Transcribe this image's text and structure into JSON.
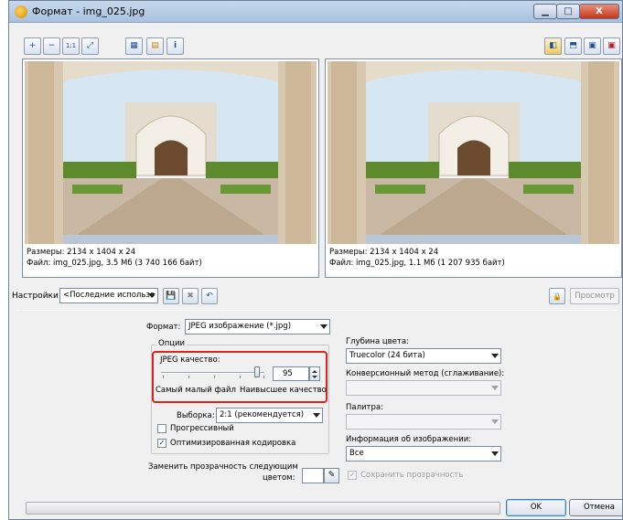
{
  "window": {
    "title": "Формат - img_025.jpg",
    "buttons": {
      "minimize": "▁",
      "maximize": "□",
      "close": "X"
    }
  },
  "toolbar": {
    "zoom_in": "+",
    "zoom_out": "−",
    "actual_size": "1:1",
    "fit": "⤢",
    "image_a": "▦",
    "image_b": "▤",
    "info": "i",
    "layout_side": "◧",
    "layout_stack": "⬒",
    "view_single": "▣",
    "view_original": "▣"
  },
  "panels": {
    "left": {
      "size": "Размеры: 2134 x 1404 x 24",
      "file": "Файл: img_025.jpg, 3.5 Мб (3 740 166 байт)"
    },
    "right": {
      "size": "Размеры: 2134 x 1404 x 24",
      "file": "Файл: img_025.jpg, 1.1 Мб (1 207 935 байт)"
    }
  },
  "settings": {
    "label": "Настройки:",
    "preset_value": "<Последние использо",
    "save_icon": "💾",
    "delete_icon": "✖",
    "reset_icon": "↶",
    "preview_label": "Просмотр",
    "lock_icon": "🔒"
  },
  "format": {
    "label": "Формат:",
    "value": "JPEG изображение (*.jpg)"
  },
  "options": {
    "title": "Опции",
    "jpeg_quality_label": "JPEG качество:",
    "quality_value": "95",
    "min_label": "Самый малый файл",
    "max_label": "Наивысшее качество",
    "sampling_label": "Выборка:",
    "sampling_value": "2:1 (рекомендуется)",
    "progressive_label": "Прогрессивный",
    "progressive_checked": false,
    "optimized_label": "Оптимизированная кодировка",
    "optimized_checked": true,
    "optimized_mark": "✓"
  },
  "quality_slider": {
    "min": 0,
    "max": 100,
    "value": 95
  },
  "color_depth": {
    "label": "Глубина цвета:",
    "value": "Truecolor (24 бита)"
  },
  "conversion": {
    "label": "Конверсионный метод (сглаживание):",
    "value": ""
  },
  "palette": {
    "label": "Палитра:",
    "value": ""
  },
  "image_info": {
    "label": "Информация об изображении:",
    "value": "Все"
  },
  "transparency": {
    "replace_label_1": "Заменить прозрачность следующим",
    "replace_label_2": "цветом:",
    "picker_icon": "✎",
    "keep_label": "Сохранить прозрачность",
    "keep_mark": "✓"
  },
  "buttons": {
    "ok": "OK",
    "cancel": "Отмена"
  },
  "colors": {
    "accent": "#e2231a",
    "titlebar": "#b9cde6"
  }
}
